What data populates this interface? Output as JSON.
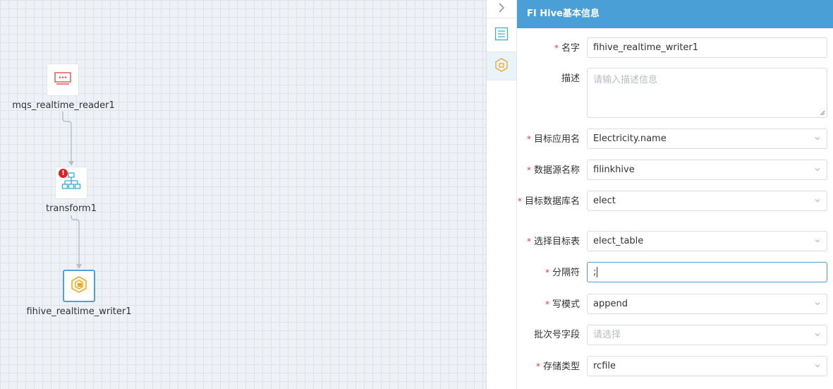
{
  "canvas": {
    "nodes": [
      {
        "id": "mqs",
        "label": "mqs_realtime_reader1",
        "icon": "message-queue-icon"
      },
      {
        "id": "transform",
        "label": "transform1",
        "icon": "org-tree-icon",
        "error_badge": "!"
      },
      {
        "id": "writer",
        "label": "fihive_realtime_writer1",
        "icon": "hive-icon",
        "selected": true
      }
    ]
  },
  "strip": {
    "items": [
      "collapse-chevron-icon",
      "list-icon",
      "hive-config-icon"
    ]
  },
  "panel": {
    "title": "FI Hive基本信息",
    "fields": {
      "name": {
        "label": "名字",
        "required": true,
        "value": "fihive_realtime_writer1"
      },
      "description": {
        "label": "描述",
        "required": false,
        "placeholder": "请输入描述信息"
      },
      "target_app": {
        "label": "目标应用名",
        "required": true,
        "value": "Electricity.name"
      },
      "datasource": {
        "label": "数据源名称",
        "required": true,
        "value": "filinkhive"
      },
      "target_db": {
        "label": "目标数据库名",
        "required": true,
        "value": "elect"
      },
      "target_table": {
        "label": "选择目标表",
        "required": true,
        "value": "elect_table"
      },
      "separator": {
        "label": "分隔符",
        "required": true,
        "value": ";"
      },
      "write_mode": {
        "label": "写模式",
        "required": true,
        "value": "append"
      },
      "batch_field": {
        "label": "批次号字段",
        "required": false,
        "placeholder": "请选择"
      },
      "storage_type": {
        "label": "存储类型",
        "required": true,
        "value": "rcfile"
      }
    }
  },
  "colors": {
    "header": "#4a9fd6",
    "required": "#e23b3b",
    "error": "#e02020",
    "selected_border": "#4aa3e0"
  }
}
